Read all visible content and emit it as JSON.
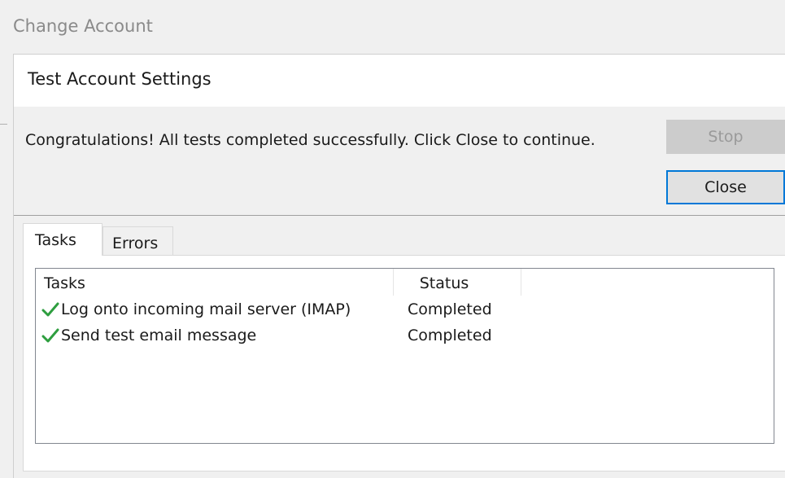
{
  "parent_window": {
    "title": "Change Account"
  },
  "dialog": {
    "title": "Test Account Settings",
    "message": "Congratulations! All tests completed successfully. Click Close to continue.",
    "buttons": {
      "stop_label": "Stop",
      "stop_enabled": false,
      "close_label": "Close"
    },
    "tabs": [
      {
        "label": "Tasks",
        "selected": true
      },
      {
        "label": "Errors",
        "selected": false
      }
    ],
    "task_list": {
      "columns": [
        "Tasks",
        "Status"
      ],
      "rows": [
        {
          "icon": "checkmark-icon",
          "task": "Log onto incoming mail server (IMAP)",
          "status": "Completed"
        },
        {
          "icon": "checkmark-icon",
          "task": "Send test email message",
          "status": "Completed"
        }
      ]
    }
  },
  "colors": {
    "checkmark": "#2e9e3f",
    "focus_border": "#0078d7",
    "disabled_button": "#cccccc"
  }
}
